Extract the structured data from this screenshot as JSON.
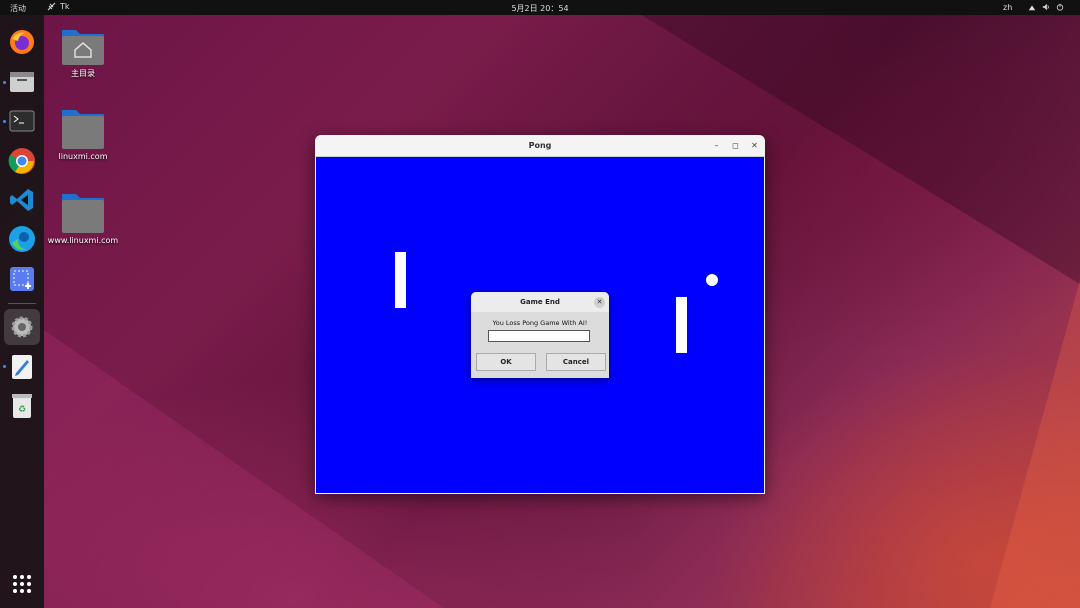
{
  "topbar": {
    "activities": "活动",
    "app_name": "Tk",
    "clock": "5月2日  20：54",
    "lang": "zh",
    "tray_icons": [
      "network-icon",
      "volume-icon",
      "power-icon"
    ]
  },
  "dock": {
    "items": [
      {
        "name": "firefox-icon",
        "running": false
      },
      {
        "name": "files-icon",
        "running": true
      },
      {
        "name": "terminal-icon",
        "running": true
      },
      {
        "name": "chrome-icon",
        "running": false
      },
      {
        "name": "vscode-icon",
        "running": false
      },
      {
        "name": "edge-icon",
        "running": false
      },
      {
        "name": "screenshot-icon",
        "running": false
      },
      {
        "name": "settings-icon",
        "running": true
      },
      {
        "name": "text-editor-icon",
        "running": true
      },
      {
        "name": "trash-icon",
        "running": false
      }
    ],
    "apps_grid": "show-apps-icon"
  },
  "desktop": {
    "icons": [
      {
        "label": "主目录",
        "type": "home-folder-icon"
      },
      {
        "label": "linuxmi.com",
        "type": "folder-icon"
      },
      {
        "label": "www.linuxmi.com",
        "type": "folder-icon"
      }
    ]
  },
  "pong_window": {
    "title": "Pong",
    "controls": [
      "–",
      "◻",
      "✕"
    ],
    "canvas_color": "#0000ff"
  },
  "dialog": {
    "title": "Game End",
    "message": "You Loss Pong Game With AI!",
    "input_value": "",
    "ok_label": "OK",
    "cancel_label": "Cancel",
    "close_glyph": "✕"
  },
  "colors": {
    "canvas": "#0000ff",
    "dock_running": "#3b8dff"
  }
}
